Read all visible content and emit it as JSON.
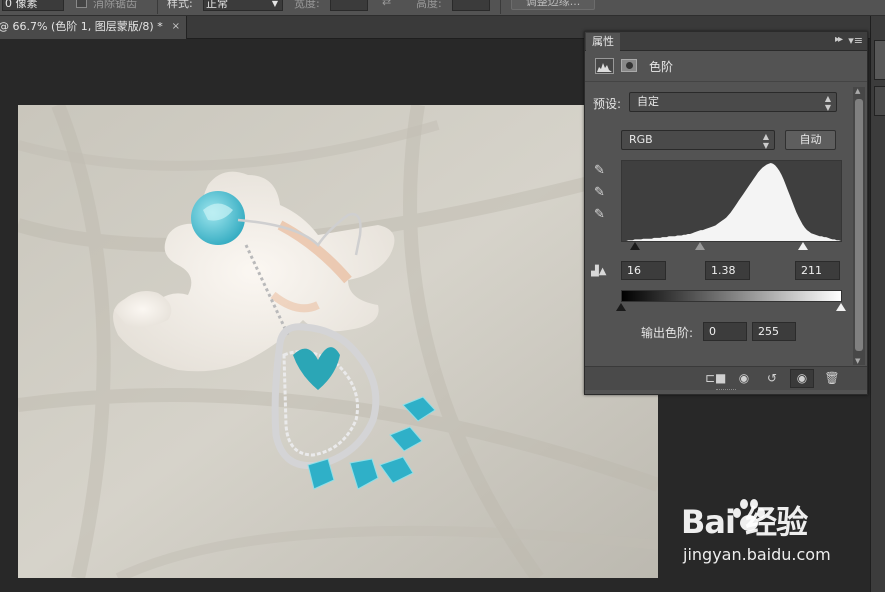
{
  "options_bar": {
    "field_unit_value": "0 像素",
    "antialias_label": "消除锯齿",
    "style_label": "样式:",
    "style_value": "正常",
    "width_label": "宽度:",
    "height_label": "高度:",
    "refine_button": "调整边缘..."
  },
  "document_tab": {
    "title": "@ 66.7% (色阶 1, 图层蒙版/8) *",
    "close": "×"
  },
  "properties_panel": {
    "tab_label": "属性",
    "collapse_glyph": "▸▸",
    "menu_glyph": "▾≡",
    "adjustment_name": "色阶",
    "preset_label": "预设:",
    "preset_value": "自定",
    "channel_value": "RGB",
    "auto_button": "自动",
    "input_black": "16",
    "input_gamma": "1.38",
    "input_white": "211",
    "output_label": "输出色阶:",
    "output_black": "0",
    "output_white": "255",
    "histogram_profile": [
      0,
      0,
      0,
      1,
      1,
      1,
      2,
      2,
      2,
      2,
      3,
      3,
      3,
      3,
      3,
      4,
      4,
      4,
      4,
      5,
      5,
      5,
      6,
      6,
      6,
      6,
      7,
      7,
      7,
      8,
      8,
      9,
      9,
      10,
      11,
      12,
      13,
      14,
      14,
      15,
      16,
      17,
      18,
      19,
      20,
      22,
      24,
      26,
      28,
      30,
      33,
      36,
      40,
      44,
      48,
      52,
      56,
      60,
      64,
      68,
      72,
      76,
      80,
      84,
      88,
      91,
      94,
      96,
      98,
      99,
      100,
      99,
      97,
      94,
      90,
      85,
      79,
      72,
      65,
      58,
      51,
      44,
      37,
      31,
      26,
      21,
      17,
      14,
      12,
      10,
      9,
      8,
      7,
      6,
      6,
      5,
      5,
      4,
      3,
      2,
      2,
      1,
      1,
      0
    ]
  },
  "footer_icons": [
    "clip-to-layer-icon",
    "view-previous-state-icon",
    "reset-icon",
    "visibility-icon",
    "delete-icon"
  ],
  "watermark": {
    "brand": "Bai  经验",
    "url": "jingyan.baidu.com"
  },
  "colors": {
    "app_bg": "#282828",
    "panel_bg": "#535353",
    "field_bg": "#3c3c3c"
  }
}
